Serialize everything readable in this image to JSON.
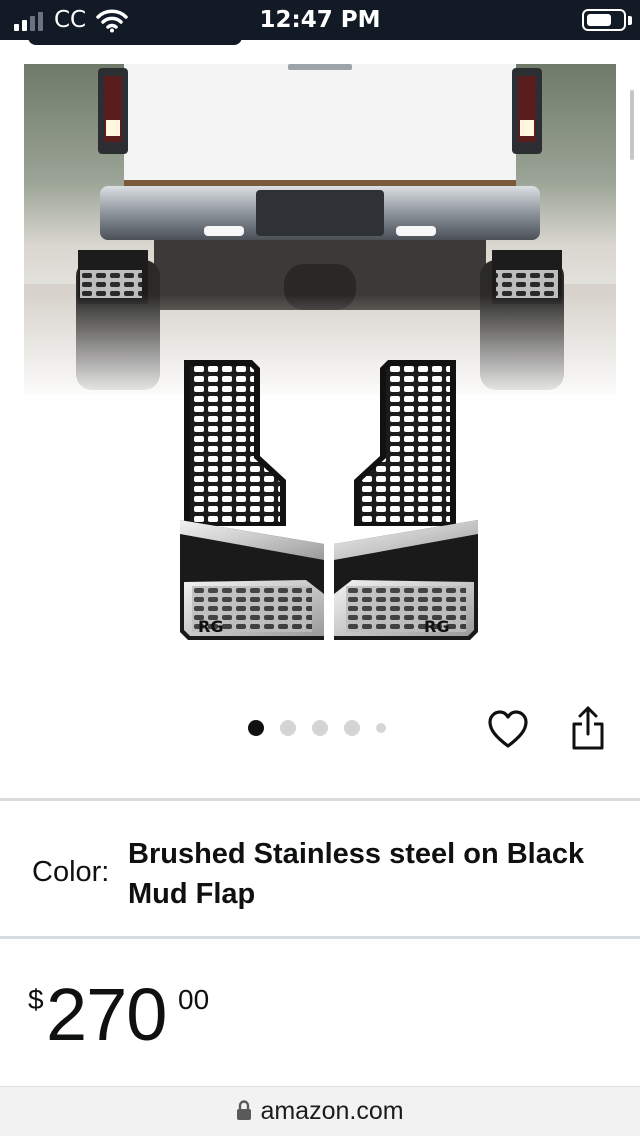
{
  "status_bar": {
    "carrier": "CC",
    "time": "12:47 PM",
    "battery_level": 0.7
  },
  "product": {
    "image_alt": "",
    "carousel": {
      "count": 5,
      "active_index": 0
    },
    "color": {
      "label": "Color:",
      "value": "Brushed Stainless steel on Black Mud Flap"
    },
    "price": {
      "currency": "$",
      "whole": "270",
      "fraction": "00"
    }
  },
  "browser": {
    "domain": "amazon.com"
  },
  "icons": {
    "signal": "signal-icon",
    "wifi": "wifi-icon",
    "battery": "battery-icon",
    "favorite": "heart-icon",
    "share": "share-icon",
    "lock": "lock-icon"
  }
}
